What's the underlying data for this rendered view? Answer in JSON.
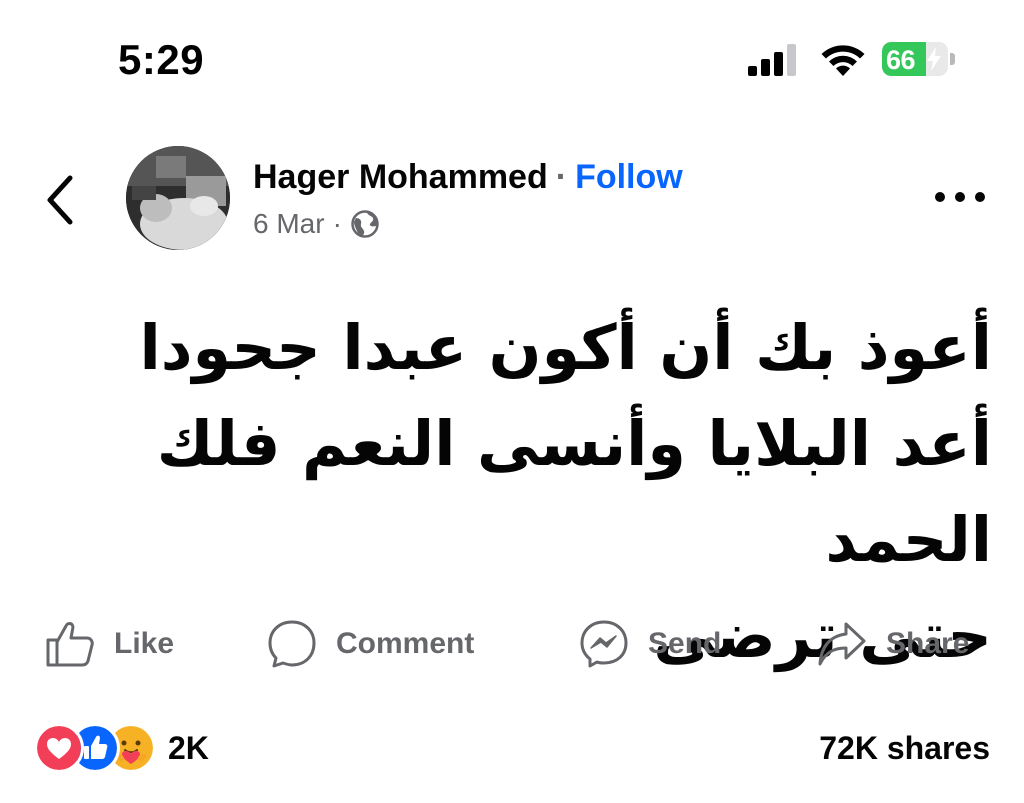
{
  "status_bar": {
    "time": "5:29",
    "battery_level": "66",
    "battery_fraction": 0.66,
    "battery_color": "#34c759",
    "icons": [
      "signal-icon",
      "wifi-icon",
      "battery-charging-icon"
    ]
  },
  "post": {
    "author": "Hager Mohammed",
    "separator": "·",
    "follow_label": "Follow",
    "date": "6 Mar",
    "meta_separator": "·",
    "audience_icon": "globe-icon",
    "text_lines": [
      "أعوذ بك أن أكون عبدا جحودا",
      "أعد البلايا وأنسى النعم فلك الحمد",
      "حتى ترضى"
    ]
  },
  "actions": {
    "like_label": "Like",
    "comment_label": "Comment",
    "send_label": "Send",
    "share_label": "Share"
  },
  "stats": {
    "reactions": [
      "love-icon",
      "like-icon",
      "care-icon"
    ],
    "reaction_count": "2K",
    "shares": "72K shares"
  },
  "colors": {
    "follow": "#0866ff",
    "secondary_text": "#65676b",
    "love": "#f33e58",
    "like": "#0866ff",
    "care": "#f7b125"
  }
}
